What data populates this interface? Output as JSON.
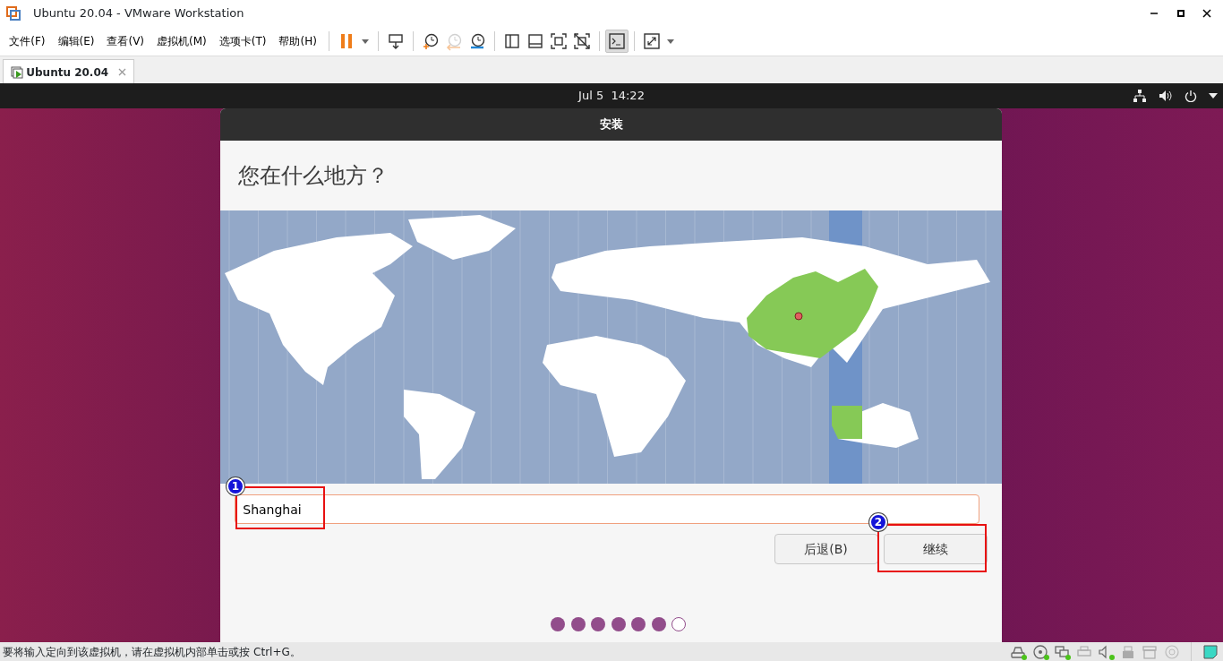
{
  "window": {
    "title": "Ubuntu 20.04 - VMware Workstation"
  },
  "menu": [
    {
      "label": "文件(F)"
    },
    {
      "label": "编辑(E)"
    },
    {
      "label": "查看(V)"
    },
    {
      "label": "虚拟机(M)"
    },
    {
      "label": "选项卡(T)"
    },
    {
      "label": "帮助(H)"
    }
  ],
  "toolbar": [
    {
      "kind": "pause",
      "selected": false,
      "disabled": false
    },
    {
      "kind": "send-keys",
      "selected": false,
      "disabled": false
    },
    {
      "kind": "snapshot",
      "selected": false,
      "disabled": false
    },
    {
      "kind": "revert",
      "selected": false,
      "disabled": true
    },
    {
      "kind": "snapshot-manager",
      "selected": false,
      "disabled": false
    },
    {
      "kind": "sidebar",
      "selected": false,
      "disabled": false
    },
    {
      "kind": "thumbnails",
      "selected": false,
      "disabled": false
    },
    {
      "kind": "fullscreen",
      "selected": false,
      "disabled": false
    },
    {
      "kind": "unity",
      "selected": false,
      "disabled": false
    },
    {
      "kind": "console",
      "selected": true,
      "disabled": false
    },
    {
      "kind": "stretch",
      "selected": false,
      "disabled": false
    }
  ],
  "tabs": [
    {
      "label": "Ubuntu 20.04",
      "selected": true
    }
  ],
  "vm_topbar": {
    "clock": "Jul 5  14:22"
  },
  "dialog": {
    "title": "安装",
    "heading": "您在什么地方？",
    "location_field": {
      "value": "Shanghai"
    },
    "buttons": [
      {
        "label": "后退(B)"
      },
      {
        "label": "继续"
      }
    ],
    "steps": [
      {
        "done": true
      },
      {
        "done": true
      },
      {
        "done": true
      },
      {
        "done": true
      },
      {
        "done": true
      },
      {
        "done": true
      },
      {
        "done": false
      }
    ]
  },
  "annotations": [
    {
      "label": "1"
    },
    {
      "label": "2"
    }
  ],
  "status_bar": {
    "message": "要将输入定向到该虚拟机，请在虚拟机内部单击或按 Ctrl+G。",
    "devices": [
      {
        "kind": "disk",
        "connected": true
      },
      {
        "kind": "cd",
        "connected": true
      },
      {
        "kind": "network",
        "connected": true
      },
      {
        "kind": "printer",
        "connected": false
      },
      {
        "kind": "sound",
        "connected": true
      },
      {
        "kind": "usb",
        "connected": false
      },
      {
        "kind": "archive",
        "connected": false
      },
      {
        "kind": "disc",
        "connected": false
      }
    ]
  }
}
